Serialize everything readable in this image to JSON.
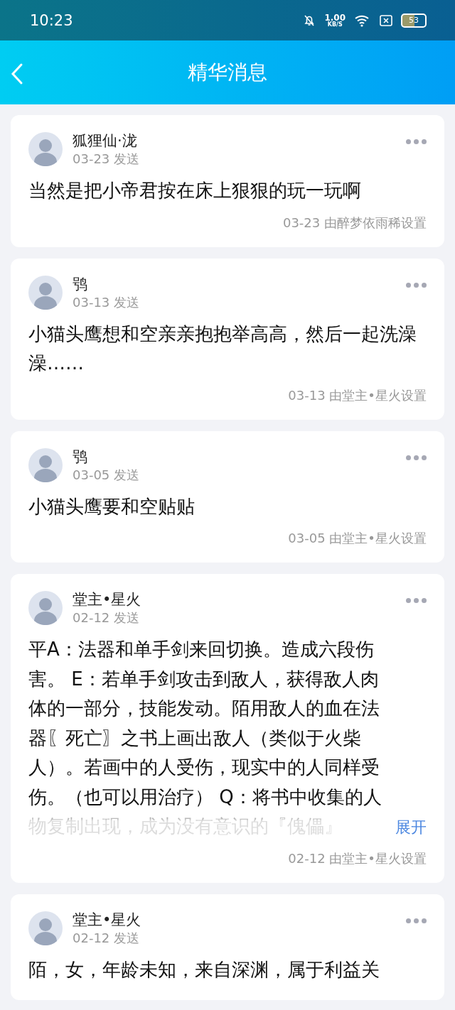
{
  "status_bar": {
    "time": "10:23",
    "net_speed": "1.00",
    "net_unit": "KB/S",
    "battery": "53"
  },
  "header": {
    "title": "精华消息"
  },
  "posts": [
    {
      "author": "狐狸仙·泷",
      "sent": "03-23 发送",
      "text": "当然是把小帝君按在床上狠狠的玩一玩啊",
      "footer": "03-23 由醉梦依雨稀设置"
    },
    {
      "author": "鸮",
      "sent": "03-13 发送",
      "text": "小猫头鹰想和空亲亲抱抱举高高，然后一起洗澡澡……",
      "footer": "03-13 由堂主•星火设置"
    },
    {
      "author": "鸮",
      "sent": "03-05 发送",
      "text": "小猫头鹰要和空贴贴",
      "footer": "03-05 由堂主•星火设置"
    },
    {
      "author": "堂主•星火",
      "sent": "02-12 发送",
      "text": "平A：法器和单手剑来回切换。造成六段伤害。 E：若单手剑攻击到敌人，获得敌人肉体的一部分，技能发动。陌用敌人的血在法器〖死亡〗之书上画出敌人（类似于火柴人）。若画中的人受伤，现实中的人同样受伤。（也可以用治疗） Q：将书中收集的人物复制出现，成为没有意识的『傀儡』",
      "expand": "展开",
      "footer": "02-12 由堂主•星火设置"
    },
    {
      "author": "堂主•星火",
      "sent": "02-12 发送",
      "text": "陌，女，年龄未知，来自深渊，属于利益关"
    }
  ]
}
